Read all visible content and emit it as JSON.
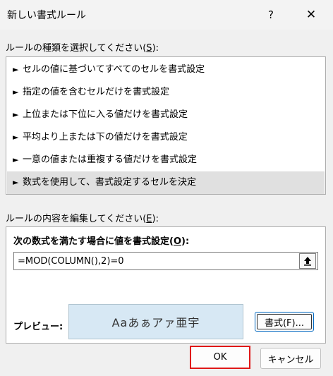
{
  "dialog": {
    "title": "新しい書式ルール",
    "help_label": "?",
    "close_label": "✕"
  },
  "rule_type": {
    "label_text": "ルールの種類を選択してください(",
    "label_key": "S",
    "label_end": "):",
    "items": [
      {
        "label": "セルの値に基づいてすべてのセルを書式設定",
        "selected": false
      },
      {
        "label": "指定の値を含むセルだけを書式設定",
        "selected": false
      },
      {
        "label": "上位または下位に入る値だけを書式設定",
        "selected": false
      },
      {
        "label": "平均より上または下の値だけを書式設定",
        "selected": false
      },
      {
        "label": "一意の値または重複する値だけを書式設定",
        "selected": false
      },
      {
        "label": "数式を使用して、書式設定するセルを決定",
        "selected": true
      }
    ],
    "arrow_icon": "►"
  },
  "rule_edit": {
    "label_text": "ルールの内容を編集してください(",
    "label_key": "E",
    "label_end": "):",
    "formula_label_text": "次の数式を満たす場合に値を書式設定(",
    "formula_label_key": "O",
    "formula_label_end": "):",
    "formula_value": "=MOD(COLUMN(),2)=0",
    "preview_label": "プレビュー:",
    "preview_sample": "Aaあぁアァ亜宇",
    "format_button": "書式(F)..."
  },
  "buttons": {
    "ok": "OK",
    "cancel": "キャンセル"
  },
  "colors": {
    "highlight_border": "#e01818",
    "preview_bg": "#d7e8f4",
    "selected_row": "#e0e0e0"
  }
}
